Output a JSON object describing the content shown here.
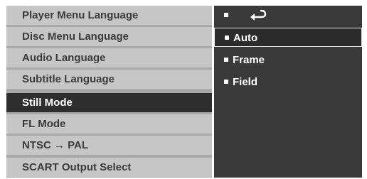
{
  "menu": {
    "items": [
      {
        "label": "Player Menu Language",
        "selected": false
      },
      {
        "label": "Disc Menu Language",
        "selected": false
      },
      {
        "label": "Audio Language",
        "selected": false
      },
      {
        "label": "Subtitle Language",
        "selected": false
      },
      {
        "label": "Still Mode",
        "selected": true
      },
      {
        "label": "FL Mode",
        "selected": false
      },
      {
        "label": "NTSC → PAL",
        "selected": false
      },
      {
        "label": "SCART Output Select",
        "selected": false
      }
    ]
  },
  "options": {
    "return_icon": "return-arrow-icon",
    "items": [
      {
        "label": "Auto",
        "highlighted": true
      },
      {
        "label": "Frame",
        "highlighted": false
      },
      {
        "label": "Field",
        "highlighted": false
      }
    ]
  },
  "colors": {
    "menu_item_bg": "#c6c6c6",
    "menu_item_text": "#3b3b3b",
    "selected_bg": "#2e2e2e",
    "selected_text": "#ffffff",
    "options_panel_bg": "#3a3a3a",
    "highlight_border": "#e6e6e6"
  }
}
